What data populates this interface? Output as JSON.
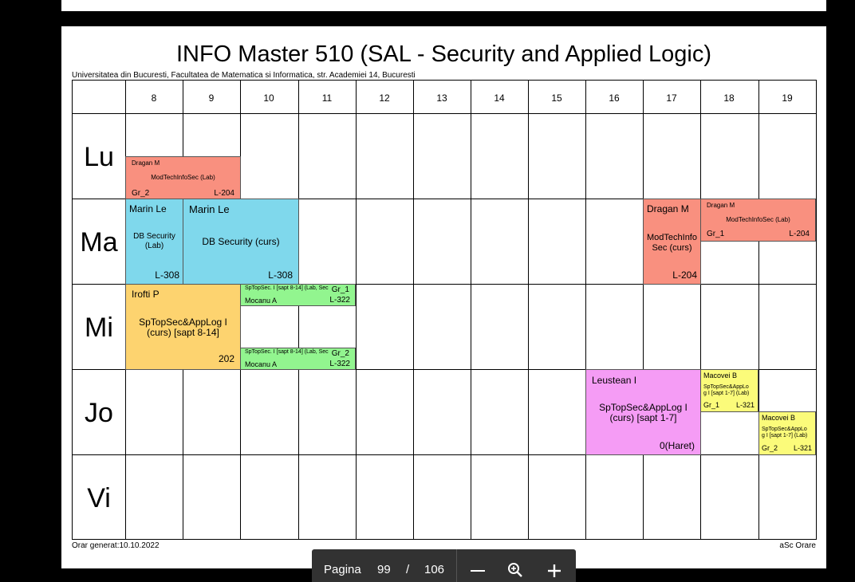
{
  "document": {
    "title": "INFO Master 510 (SAL - Security and Applied Logic)",
    "subtitle": "Universitatea din Bucuresti, Facultatea de Matematica si Informatica, str. Academiei 14, Bucuresti",
    "footer_left": "Orar generat:10.10.2022",
    "footer_right": "aSc Orare"
  },
  "hours": [
    "8",
    "9",
    "10",
    "11",
    "12",
    "13",
    "14",
    "15",
    "16",
    "17",
    "18",
    "19"
  ],
  "days": [
    "Lu",
    "Ma",
    "Mi",
    "Jo",
    "Vi"
  ],
  "blocks": {
    "lu_dragan": {
      "teacher": "Dragan M",
      "course": "ModTechInfoSec (Lab)",
      "group": "Gr_2",
      "room": "L-204"
    },
    "ma_lab": {
      "teacher": "Marin Le",
      "course_line1": "DB Security",
      "course_line2": "(Lab)",
      "room": "L-308"
    },
    "ma_curs": {
      "teacher": "Marin Le",
      "course": "DB Security (curs)",
      "room": "L-308"
    },
    "ma_dragan_curs": {
      "teacher": "Dragan M",
      "course_line1": "ModTechInfo",
      "course_line2": "Sec (curs)",
      "room": "L-204"
    },
    "ma_dragan_lab": {
      "teacher": "Dragan M",
      "course": "ModTechInfoSec (Lab)",
      "group": "Gr_1",
      "room": "L-204"
    },
    "mi_irofti": {
      "teacher": "Irofti P",
      "course_line1": "SpTopSec&AppLog I",
      "course_line2": "(curs) [sapt 8-14]",
      "room": "202"
    },
    "mi_gr1": {
      "course": "SpTopSec. I [sapt 8-14] (Lab, Sec",
      "group": "Gr_1",
      "teacher": "Mocanu A",
      "room": "L-322"
    },
    "mi_gr2": {
      "course": "SpTopSec. I [sapt 8-14] (Lab, Sec",
      "group": "Gr_2",
      "teacher": "Mocanu A",
      "room": "L-322"
    },
    "jo_leustean": {
      "teacher": "Leustean I",
      "course_line1": "SpTopSec&AppLog I",
      "course_line2": "(curs) [sapt 1-7]",
      "room": "0(Haret)"
    },
    "jo_macovei1": {
      "teacher": "Macovei B",
      "course_line1": "SpTopSec&AppLo",
      "course_line2": "g I [sapt 1-7] (Lab)",
      "group": "Gr_1",
      "room": "L-321"
    },
    "jo_macovei2": {
      "teacher": "Macovei B",
      "course_line1": "SpTopSec&AppLo",
      "course_line2": "g I [sapt 1-7] (Lab)",
      "group": "Gr_2",
      "room": "L-321"
    }
  },
  "colors": {
    "cyan": "#7fd8ec",
    "salmon": "#f9907f",
    "orange": "#fdd36f",
    "green": "#92f58f",
    "pink": "#f59cf5",
    "yellow": "#fbfb7a"
  },
  "viewer": {
    "page_label": "Pagina",
    "current_page": "99",
    "separator": "/",
    "total_pages": "106",
    "icons": [
      "zoom-out-icon",
      "zoom-fit-icon",
      "zoom-in-icon"
    ]
  }
}
